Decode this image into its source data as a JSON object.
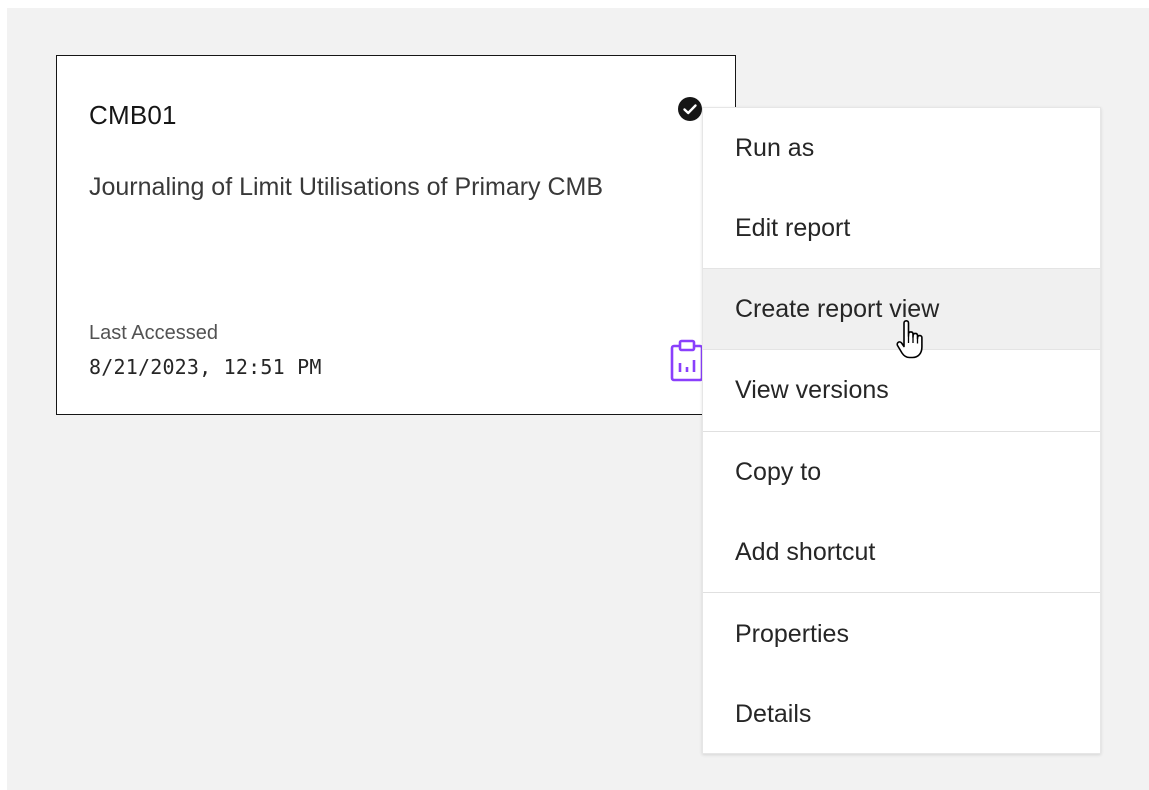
{
  "card": {
    "title": "CMB01",
    "description": "Journaling of Limit Utilisations of Primary CMB",
    "last_accessed_label": "Last Accessed",
    "last_accessed_value": "8/21/2023, 12:51 PM",
    "status_icon": "checkmark-filled-icon",
    "type_icon": "report-clipboard-icon",
    "accent_color": "#8a3ffc"
  },
  "menu": {
    "items": [
      {
        "label": "Run as"
      },
      {
        "label": "Edit report"
      },
      {
        "label": "Create report view",
        "hovered": true
      },
      {
        "label": "View versions"
      },
      {
        "label": "Copy to"
      },
      {
        "label": "Add shortcut"
      },
      {
        "label": "Properties"
      },
      {
        "label": "Details"
      }
    ]
  },
  "cursor": {
    "icon": "hand-pointer-icon"
  }
}
